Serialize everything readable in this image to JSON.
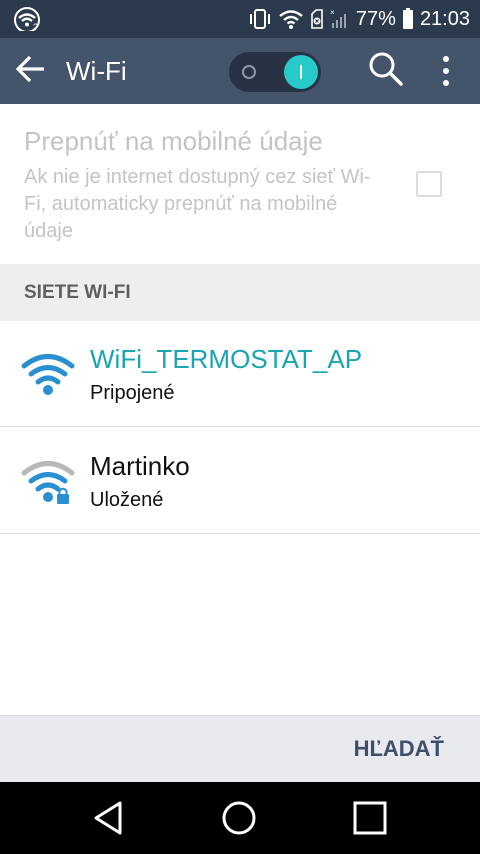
{
  "status_bar": {
    "battery_percent": "77%",
    "time": "21:03",
    "icons": [
      "wifi-notification-icon",
      "vibrate-icon",
      "wifi-signal-icon",
      "no-sim-icon",
      "cellular-signal-icon",
      "battery-icon"
    ]
  },
  "app_bar": {
    "title": "Wi-Fi",
    "wifi_enabled": true,
    "icons": [
      "back-arrow-icon",
      "search-icon",
      "overflow-menu-icon"
    ]
  },
  "mobile_data_option": {
    "title": "Prepnúť na mobilné údaje",
    "description": "Ak nie je internet dostupný cez sieť Wi-Fi, automaticky prepnúť na mobilné údaje",
    "checked": false,
    "enabled": false
  },
  "section_header": "SIETE WI-FI",
  "networks": [
    {
      "name": "WiFi_TERMOSTAT_AP",
      "status": "Pripojené",
      "name_color": "#1aa5b0",
      "icon": "wifi-full-icon"
    },
    {
      "name": "Martinko",
      "status": "Uložené",
      "name_color": "#111111",
      "icon": "wifi-secured-icon"
    }
  ],
  "action_bar": {
    "scan_label": "HĽADAŤ"
  },
  "nav_bar": {
    "icons": [
      "nav-back-icon",
      "nav-home-icon",
      "nav-recents-icon"
    ]
  },
  "colors": {
    "status_bar_bg": "#2c3a4d",
    "app_bar_bg": "#44546b",
    "accent": "#27c9c9",
    "wifi_icon_blue": "#2a8fd0"
  }
}
